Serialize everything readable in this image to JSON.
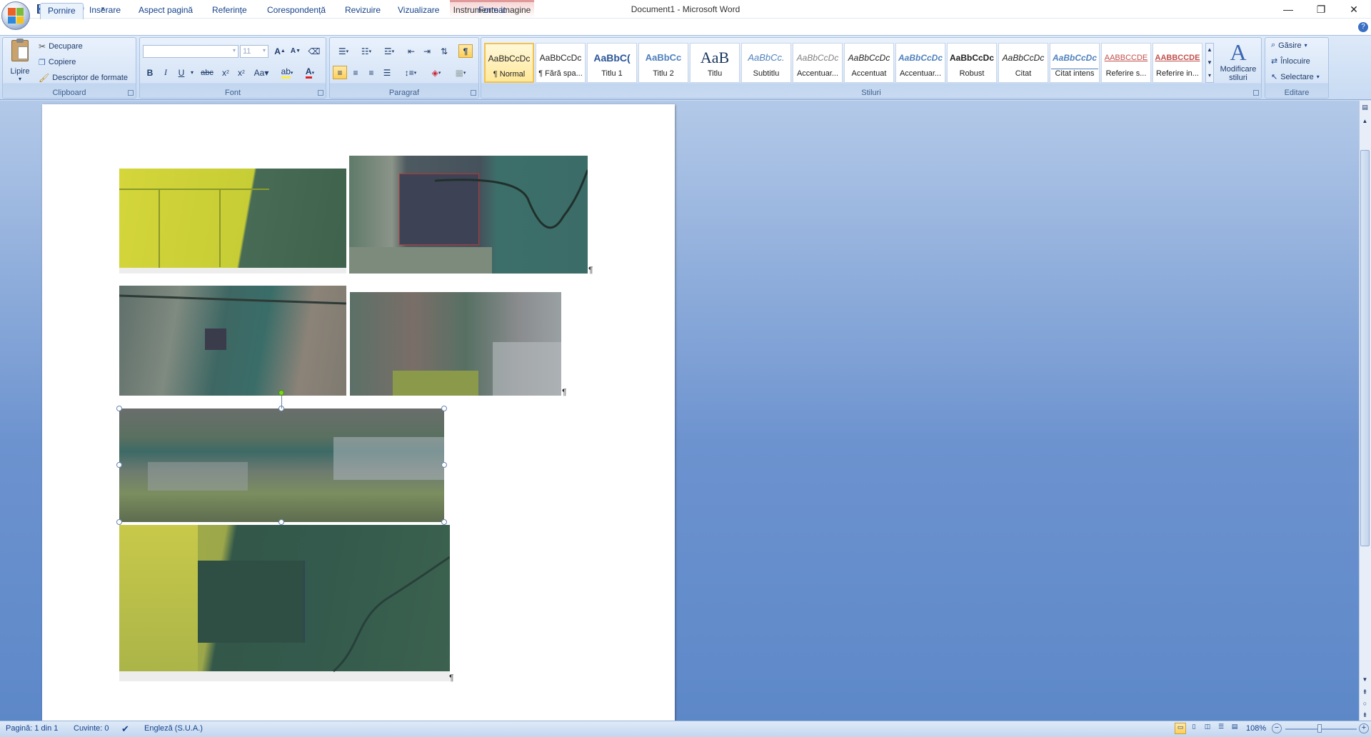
{
  "window": {
    "title": "Document1 - Microsoft Word",
    "contextual_group": "Instrumente imagine"
  },
  "tabs": [
    "Pornire",
    "Inserare",
    "Aspect pagină",
    "Referințe",
    "Corespondență",
    "Revizuire",
    "Vizualizare",
    "Format"
  ],
  "clipboard": {
    "paste": "Lipire",
    "cut": "Decupare",
    "copy": "Copiere",
    "format_painter": "Descriptor de formate",
    "label": "Clipboard"
  },
  "font": {
    "name_value": "",
    "size_value": "11",
    "label": "Font"
  },
  "paragraph": {
    "label": "Paragraf"
  },
  "styles": {
    "label": "Stiluri",
    "items": [
      {
        "preview": "AaBbCcDc",
        "name": "¶ Normal"
      },
      {
        "preview": "AaBbCcDc",
        "name": "¶ Fără spa..."
      },
      {
        "preview": "AaBbC(",
        "name": "Titlu 1"
      },
      {
        "preview": "AaBbCc",
        "name": "Titlu 2"
      },
      {
        "preview": "AaB",
        "name": "Titlu"
      },
      {
        "preview": "AaBbCc.",
        "name": "Subtitlu"
      },
      {
        "preview": "AaBbCcDc",
        "name": "Accentuar..."
      },
      {
        "preview": "AaBbCcDc",
        "name": "Accentuat"
      },
      {
        "preview": "AaBbCcDc",
        "name": "Accentuar..."
      },
      {
        "preview": "AaBbCcDc",
        "name": "Robust"
      },
      {
        "preview": "AaBbCcDc",
        "name": "Citat"
      },
      {
        "preview": "AaBbCcDc",
        "name": "Citat intens"
      },
      {
        "preview": "AABBCCDE",
        "name": "Referire s..."
      },
      {
        "preview": "AABBCCDE",
        "name": "Referire in..."
      }
    ],
    "change_styles": "Modificare stiluri"
  },
  "editing": {
    "label": "Editare",
    "find": "Găsire",
    "replace": "Înlocuire",
    "select": "Selectare"
  },
  "status": {
    "page": "Pagină: 1 din 1",
    "words": "Cuvinte: 0",
    "language": "Engleză (S.U.A.)",
    "zoom": "108%"
  },
  "colors": {
    "accent": "#15428b",
    "ribbon": "#dbe7f7",
    "workspace": "#6d93cf"
  }
}
